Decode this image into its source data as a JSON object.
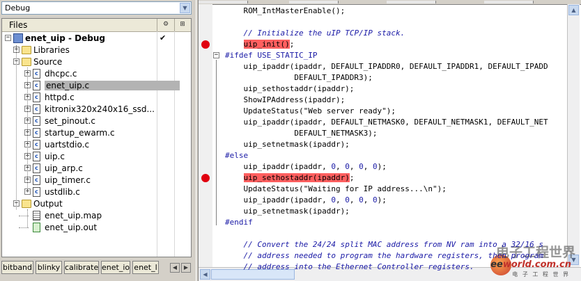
{
  "config_combo": {
    "value": "Debug"
  },
  "workspace": {
    "header_label": "Files",
    "project": {
      "name": "enet_uip - Debug",
      "check": "✔"
    },
    "groups": [
      {
        "name": "Libraries"
      },
      {
        "name": "Source"
      },
      {
        "name": "Output"
      }
    ],
    "source_files": [
      "dhcpc.c",
      "enet_uip.c",
      "httpd.c",
      "kitronix320x240x16_ssd...",
      "set_pinout.c",
      "startup_ewarm.c",
      "uartstdio.c",
      "uip.c",
      "uip_arp.c",
      "uip_timer.c",
      "ustdlib.c"
    ],
    "selected_file": "enet_uip.c",
    "output_files": [
      "enet_uip.map",
      "enet_uip.out"
    ]
  },
  "tabs": [
    "bitband",
    "blinky",
    "calibrate",
    "enet_io",
    "enet_l"
  ],
  "code_lines": [
    {
      "segs": [
        {
          "t": "    ROM_IntMasterEnable();"
        }
      ]
    },
    {
      "segs": [
        {
          "t": ""
        }
      ]
    },
    {
      "segs": [
        {
          "t": "    "
        },
        {
          "t": "// Initialize the uIP TCP/IP stack.",
          "c": "cmt"
        }
      ]
    },
    {
      "segs": [
        {
          "t": "    "
        },
        {
          "t": "uip_init()",
          "c": "hl"
        },
        {
          "t": ";"
        }
      ],
      "bp": true
    },
    {
      "segs": [
        {
          "t": "#ifdef USE_STATIC_IP",
          "c": "pp"
        }
      ],
      "fold": "⊟"
    },
    {
      "segs": [
        {
          "t": "    uip_ipaddr(ipaddr, DEFAULT_IPADDR0, DEFAULT_IPADDR1, DEFAULT_IPADD"
        }
      ]
    },
    {
      "segs": [
        {
          "t": "               DEFAULT_IPADDR3);"
        }
      ]
    },
    {
      "segs": [
        {
          "t": "    uip_sethostaddr(ipaddr);"
        }
      ]
    },
    {
      "segs": [
        {
          "t": "    ShowIPAddress(ipaddr);"
        }
      ]
    },
    {
      "segs": [
        {
          "t": "    UpdateStatus(\"Web server ready\");"
        }
      ]
    },
    {
      "segs": [
        {
          "t": "    uip_ipaddr(ipaddr, DEFAULT_NETMASK0, DEFAULT_NETMASK1, DEFAULT_NET"
        }
      ]
    },
    {
      "segs": [
        {
          "t": "               DEFAULT_NETMASK3);"
        }
      ]
    },
    {
      "segs": [
        {
          "t": "    uip_setnetmask(ipaddr);"
        }
      ]
    },
    {
      "segs": [
        {
          "t": "#else",
          "c": "pp"
        }
      ]
    },
    {
      "segs": [
        {
          "t": "    uip_ipaddr(ipaddr, "
        },
        {
          "t": "0",
          "c": "num"
        },
        {
          "t": ", "
        },
        {
          "t": "0",
          "c": "num"
        },
        {
          "t": ", "
        },
        {
          "t": "0",
          "c": "num"
        },
        {
          "t": ", "
        },
        {
          "t": "0",
          "c": "num"
        },
        {
          "t": ");"
        }
      ]
    },
    {
      "segs": [
        {
          "t": "    "
        },
        {
          "t": "uip_sethostaddr(ipaddr)",
          "c": "hl"
        },
        {
          "t": ";"
        }
      ],
      "bp": true
    },
    {
      "segs": [
        {
          "t": "    UpdateStatus(\"Waiting for IP address...\\n\");"
        }
      ]
    },
    {
      "segs": [
        {
          "t": "    uip_ipaddr(ipaddr, "
        },
        {
          "t": "0",
          "c": "num"
        },
        {
          "t": ", "
        },
        {
          "t": "0",
          "c": "num"
        },
        {
          "t": ", "
        },
        {
          "t": "0",
          "c": "num"
        },
        {
          "t": ", "
        },
        {
          "t": "0",
          "c": "num"
        },
        {
          "t": ");"
        }
      ]
    },
    {
      "segs": [
        {
          "t": "    uip_setnetmask(ipaddr);"
        }
      ]
    },
    {
      "segs": [
        {
          "t": "#endif",
          "c": "pp"
        }
      ]
    },
    {
      "segs": [
        {
          "t": ""
        }
      ]
    },
    {
      "segs": [
        {
          "t": "    "
        },
        {
          "t": "// Convert the 24/24 split MAC address from NV ram into a 32/16 s",
          "c": "cmt"
        }
      ]
    },
    {
      "segs": [
        {
          "t": "    "
        },
        {
          "t": "// address needed to program the hardware registers, then program",
          "c": "cmt"
        }
      ]
    },
    {
      "segs": [
        {
          "t": "    "
        },
        {
          "t": "// address into the Ethernet Controller registers.",
          "c": "cmt"
        }
      ]
    }
  ],
  "watermark": {
    "line1": "电子工程世界",
    "line2a": "ee",
    "line2b": "world.com.cn",
    "line3": "电 子 工 程 世 界"
  },
  "colors": {
    "breakpoint": "#e0000f",
    "highlight": "#ff5f5f",
    "comment": "#1a1aa6",
    "selection": "#b3b3b3"
  }
}
